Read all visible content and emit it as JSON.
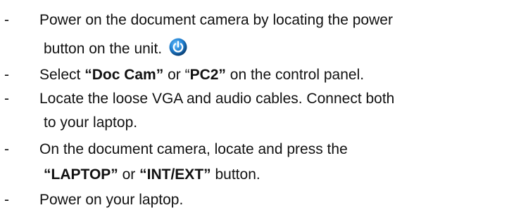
{
  "steps": [
    {
      "lines": [
        {
          "segments": [
            {
              "text": "Power on the document camera by locating the power",
              "bold": false
            }
          ]
        },
        {
          "segments": [
            {
              "text": "button on the unit. ",
              "bold": false
            }
          ],
          "icon": "power-button-icon"
        }
      ]
    },
    {
      "lines": [
        {
          "segments": [
            {
              "text": "Select ",
              "bold": false
            },
            {
              "text": "“Doc Cam”",
              "bold": true
            },
            {
              "text": " or “",
              "bold": false
            },
            {
              "text": "PC2”",
              "bold": true
            },
            {
              "text": " on the control panel.",
              "bold": false
            }
          ]
        }
      ]
    },
    {
      "lines": [
        {
          "segments": [
            {
              "text": "Locate the loose VGA and audio cables. Connect both",
              "bold": false
            }
          ]
        },
        {
          "segments": [
            {
              "text": "to your laptop.",
              "bold": false
            }
          ]
        }
      ]
    },
    {
      "lines": [
        {
          "segments": [
            {
              "text": "On the document camera, locate and press the",
              "bold": false
            }
          ]
        },
        {
          "segments": [
            {
              "text": "“LAPTOP”",
              "bold": true
            },
            {
              "text": " or ",
              "bold": false
            },
            {
              "text": "“INT/EXT”",
              "bold": true
            },
            {
              "text": " button.",
              "bold": false
            }
          ]
        }
      ]
    },
    {
      "lines": [
        {
          "segments": [
            {
              "text": "Power on your laptop.",
              "bold": false
            }
          ]
        }
      ]
    }
  ],
  "bullet": "-",
  "icon_colors": {
    "power_outer": "#0a4f8a",
    "power_inner": "#3fa0e6"
  }
}
